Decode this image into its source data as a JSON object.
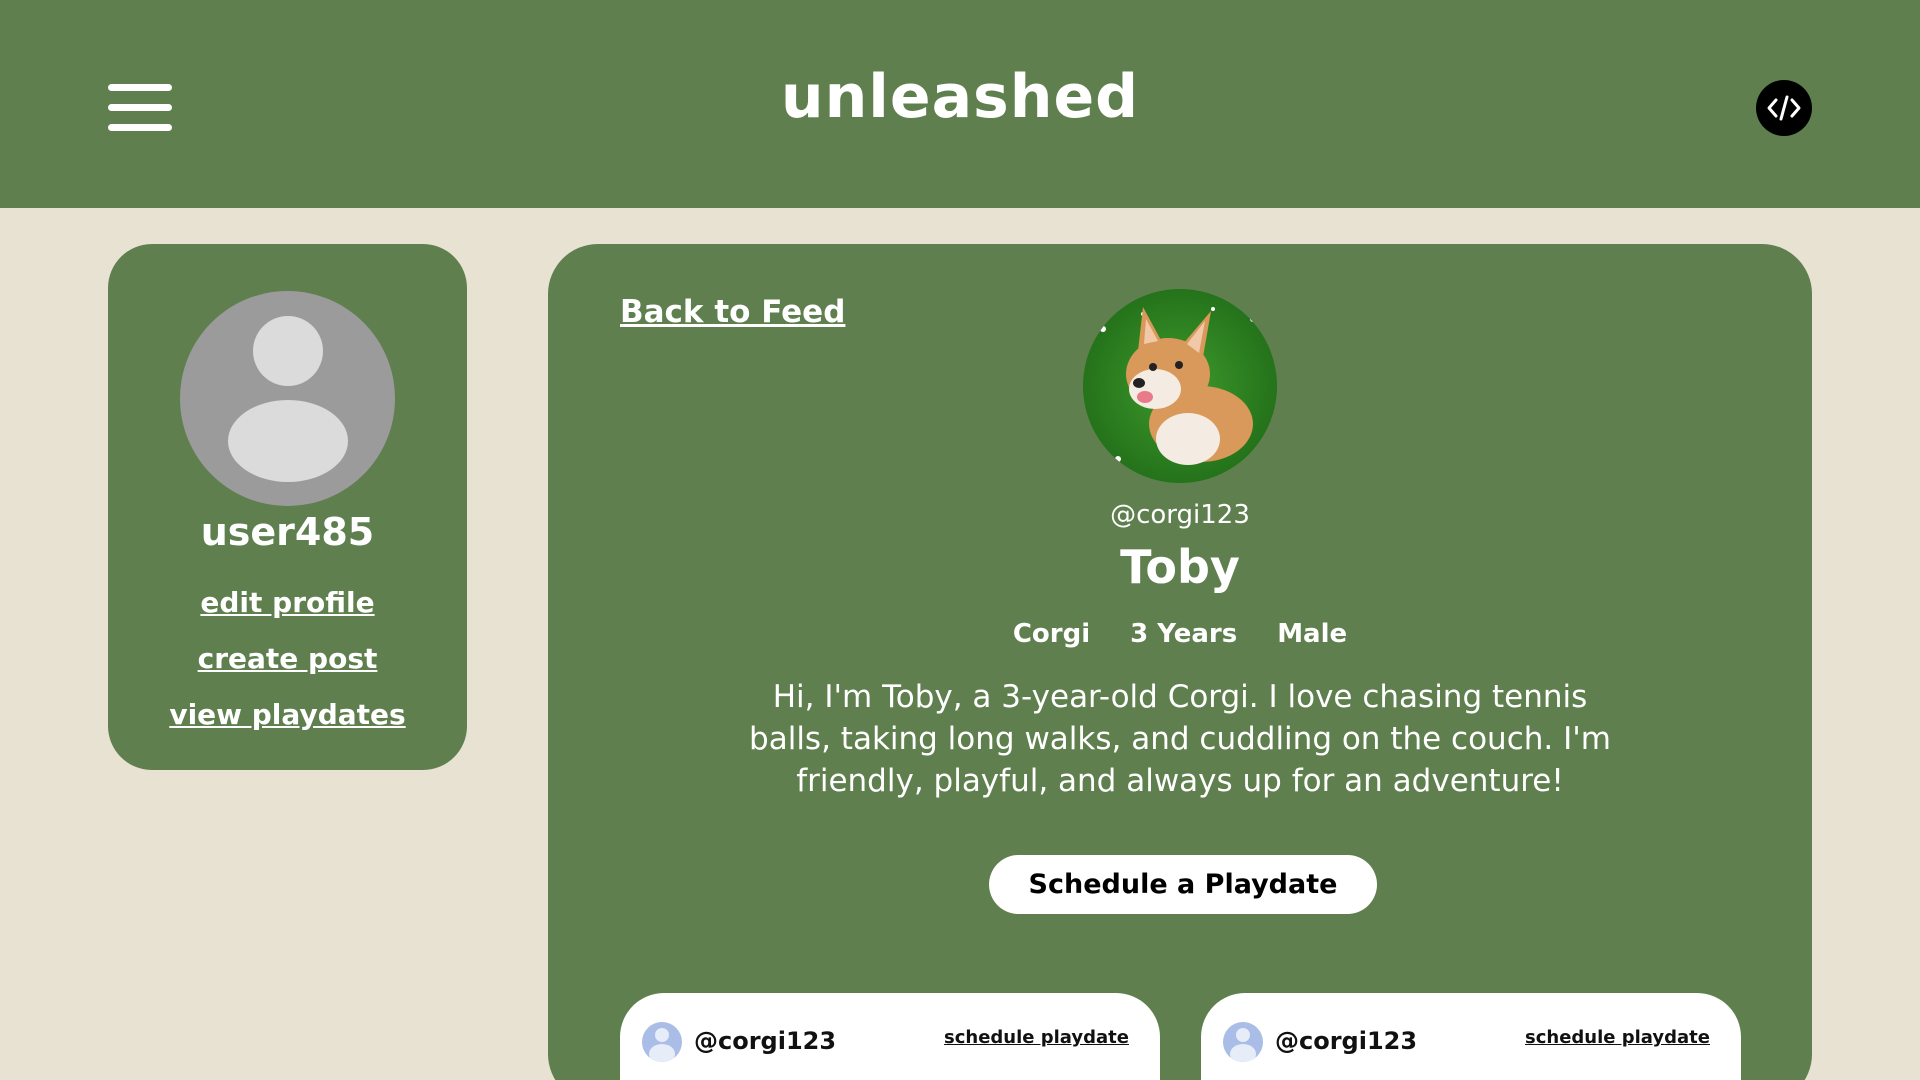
{
  "header": {
    "brand": "unleashed",
    "menu_icon": "hamburger-menu-icon",
    "code_icon": "code-icon"
  },
  "sidebar": {
    "username": "user485",
    "links": [
      "edit profile",
      "create post",
      "view playdates"
    ]
  },
  "profile": {
    "back_link": "Back to Feed",
    "handle": "@corgi123",
    "name": "Toby",
    "breed": "Corgi",
    "age": "3 Years",
    "sex": "Male",
    "bio": "Hi, I'm Toby, a 3-year-old Corgi. I love chasing tennis balls, taking long walks, and cuddling on the couch. I'm friendly, playful, and always up for an adventure!",
    "schedule_button": "Schedule a Playdate"
  },
  "posts": [
    {
      "handle": "@corgi123",
      "action": "schedule playdate"
    },
    {
      "handle": "@corgi123",
      "action": "schedule playdate"
    }
  ],
  "colors": {
    "brand_green": "#5f7f4e",
    "background_cream": "#e8e2d3"
  }
}
